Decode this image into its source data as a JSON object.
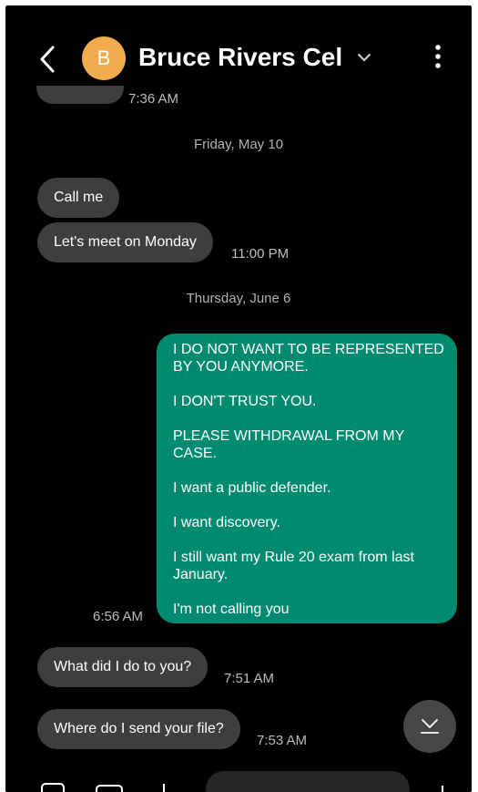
{
  "header": {
    "avatar_letter": "B",
    "contact_name": "Bruce Rivers Cel"
  },
  "messages": {
    "partial_time": "7:36 AM",
    "date1": "Friday, May 10",
    "m1": "Call me",
    "m2": "Let's meet on Monday",
    "m2_time": "11:00 PM",
    "date2": "Thursday, June 6",
    "sent_paragraphs": [
      "I DO NOT WANT TO BE REPRESENTED BY YOU ANYMORE.",
      "I DON'T TRUST YOU.",
      "PLEASE WITHDRAWAL FROM MY CASE.",
      "I want a public defender.",
      "I want discovery.",
      "I still want my Rule 20 exam from last January.",
      "I'm not calling you"
    ],
    "sent_time": "6:56 AM",
    "m3": "What did I do to you?",
    "m3_time": "7:51 AM",
    "m4": "Where do I send your file?",
    "m4_time": "7:53 AM"
  },
  "colors": {
    "background": "#000000",
    "received_bubble": "#3e3e3e",
    "sent_bubble": "#008a6f",
    "avatar": "#f2ac4d"
  },
  "icons": [
    "back-arrow-icon",
    "chevron-down-icon",
    "more-vert-icon",
    "scroll-down-icon"
  ]
}
